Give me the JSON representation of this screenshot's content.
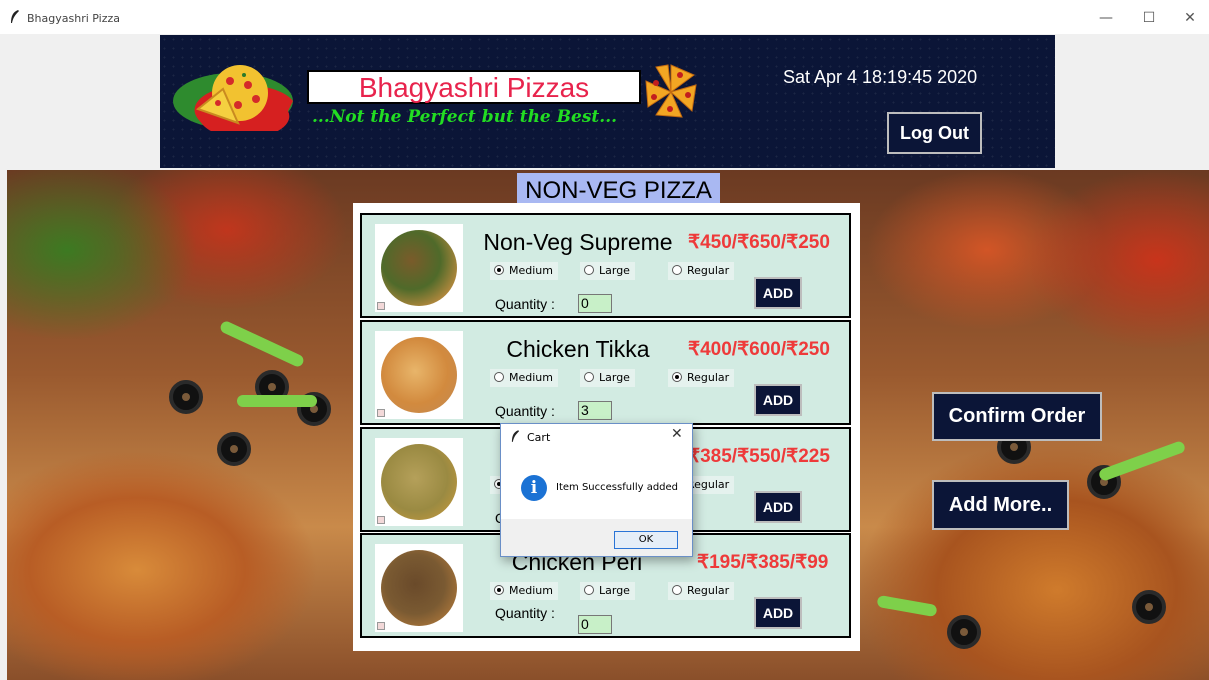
{
  "window": {
    "title": "Bhagyashri Pizza",
    "minimize_glyph": "—",
    "maximize_glyph": "☐",
    "close_glyph": "✕"
  },
  "header": {
    "brand": "Bhagyashri Pizzas",
    "tagline": "...Not the Perfect but the Best...",
    "datetime": "Sat Apr  4 18:19:45 2020",
    "logout_label": "Log Out"
  },
  "section_title": "NON-VEG PIZZA",
  "quantity_label": "Quantity :",
  "add_label": "ADD",
  "size_options": [
    "Medium",
    "Large",
    "Regular"
  ],
  "items": [
    {
      "name": "Non-Veg Supreme",
      "price": "₹450/₹650/₹250",
      "selected": "Medium",
      "quantity": "0"
    },
    {
      "name": "Chicken Tikka",
      "price": "₹400/₹600/₹250",
      "selected": "Regular",
      "quantity": "3"
    },
    {
      "name": "C",
      "price": "₹385/₹550/₹225",
      "selected": "Medium",
      "quantity": ""
    },
    {
      "name": "Chicken Peri",
      "price": "₹195/₹385/₹99",
      "selected": "Medium",
      "quantity": "0"
    }
  ],
  "side_buttons": {
    "confirm": "Confirm Order",
    "add_more": "Add More.."
  },
  "dialog": {
    "title": "Cart",
    "message": "Item Successfully added",
    "ok": "OK",
    "close_glyph": "✕",
    "icon_glyph": "i"
  },
  "colors": {
    "banner": "#0b1537",
    "brand_text": "#e8234c",
    "tagline": "#22dd22",
    "price": "#ee3a3a",
    "card": "#d2ebe2",
    "section_title_bg": "#a9b8f2"
  }
}
